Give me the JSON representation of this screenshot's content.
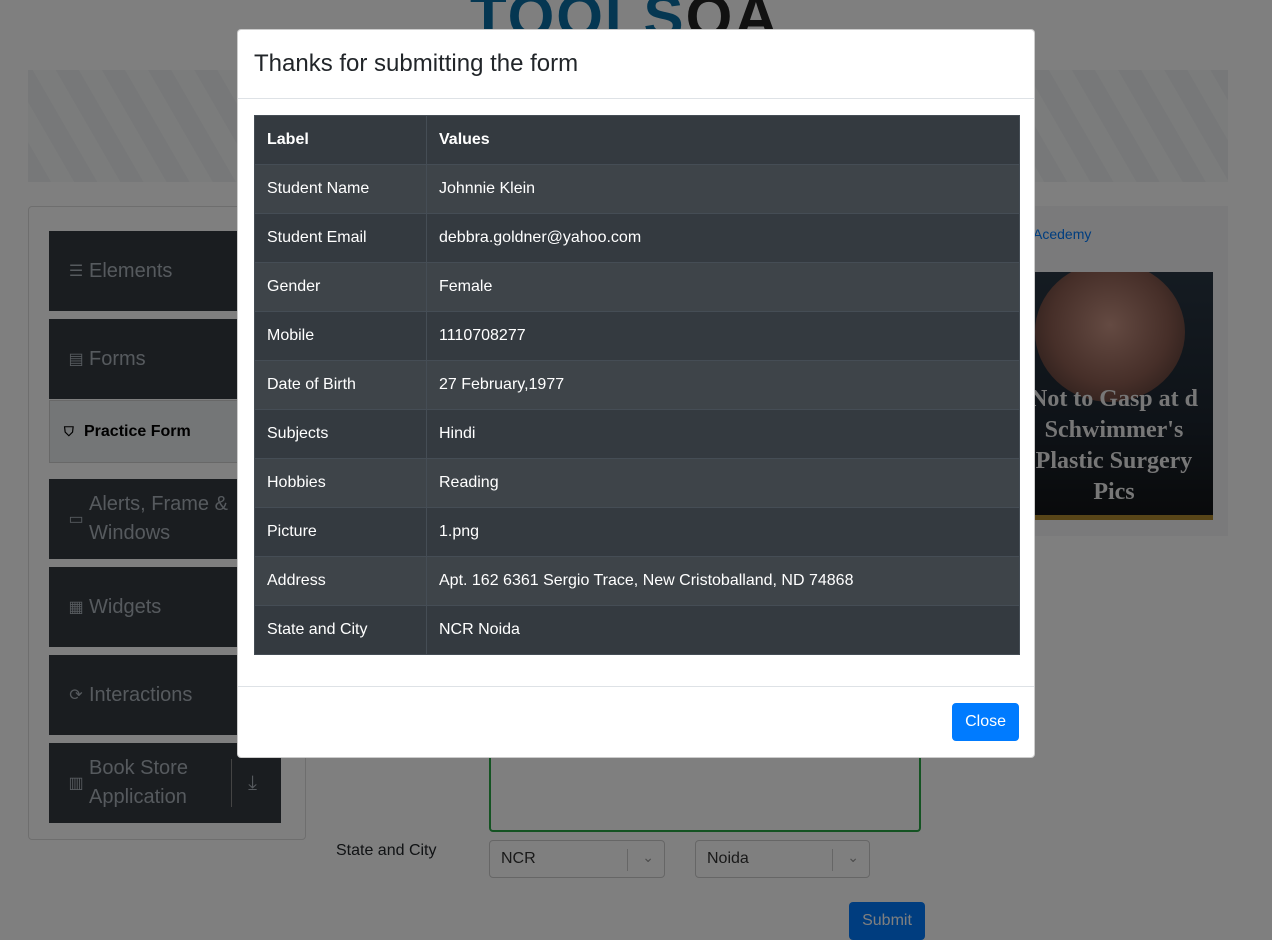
{
  "brand": {
    "logo_text": "TOOLS",
    "logo_suffix": "QA"
  },
  "sidebar": {
    "groups": [
      {
        "label": "Elements",
        "icon": "list-icon"
      },
      {
        "label": "Forms",
        "icon": "document-icon"
      },
      {
        "label": "Alerts, Frame & Windows",
        "icon": "window-icon"
      },
      {
        "label": "Widgets",
        "icon": "widgets-icon"
      },
      {
        "label": "Interactions",
        "icon": "refresh-icon"
      },
      {
        "label": "Book Store Application",
        "icon": "books-icon"
      }
    ],
    "active_item": {
      "label": "Practice Form",
      "icon": "html5-icon"
    }
  },
  "ad": {
    "link_text": "Acedemy",
    "headline": "Not to Gasp at d Schwimmer's Plastic Surgery Pics"
  },
  "form": {
    "state_city_label": "State and City",
    "state_value": "NCR",
    "city_value": "Noida",
    "submit_label": "Submit"
  },
  "modal": {
    "title": "Thanks for submitting the form",
    "columns": [
      "Label",
      "Values"
    ],
    "rows": [
      {
        "label": "Student Name",
        "value": "Johnnie Klein"
      },
      {
        "label": "Student Email",
        "value": "debbra.goldner@yahoo.com"
      },
      {
        "label": "Gender",
        "value": "Female"
      },
      {
        "label": "Mobile",
        "value": "1110708277"
      },
      {
        "label": "Date of Birth",
        "value": "27 February,1977"
      },
      {
        "label": "Subjects",
        "value": "Hindi"
      },
      {
        "label": "Hobbies",
        "value": "Reading"
      },
      {
        "label": "Picture",
        "value": "1.png"
      },
      {
        "label": "Address",
        "value": "Apt. 162 6361 Sergio Trace, New Cristoballand, ND 74868"
      },
      {
        "label": "State and City",
        "value": "NCR Noida"
      }
    ],
    "close_label": "Close"
  }
}
